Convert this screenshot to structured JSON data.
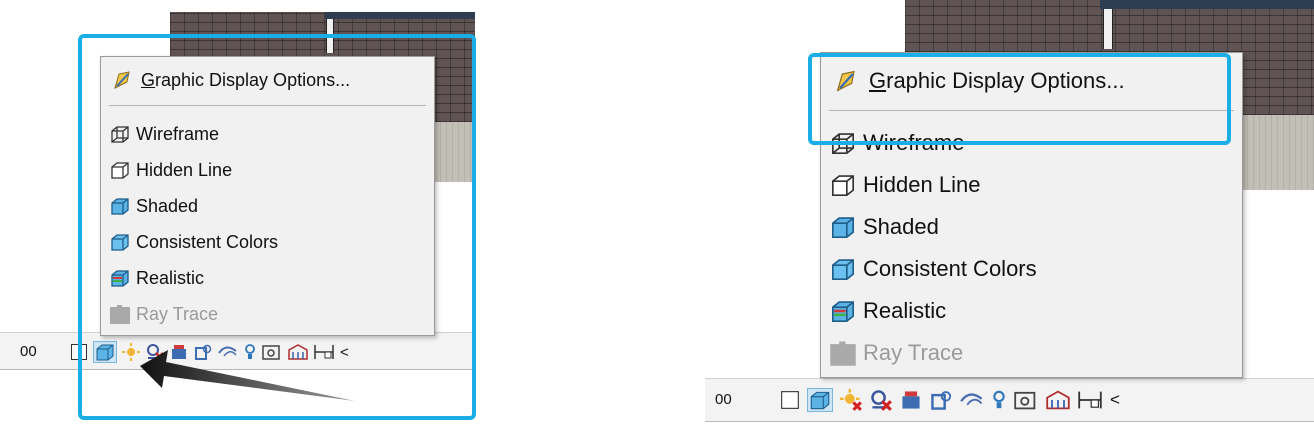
{
  "menu": {
    "graphic_display_options": {
      "prefix": "",
      "mnemonic": "G",
      "rest": "raphic Display Options..."
    },
    "items": [
      {
        "label": "Wireframe",
        "icon": "wireframe-icon"
      },
      {
        "label": "Hidden Line",
        "icon": "hidden-line-icon"
      },
      {
        "label": "Shaded",
        "icon": "shaded-icon"
      },
      {
        "label": "Consistent Colors",
        "icon": "consistent-colors-icon"
      },
      {
        "label": "Realistic",
        "icon": "realistic-icon"
      },
      {
        "label": "Ray Trace",
        "icon": "ray-trace-icon",
        "disabled": true
      }
    ]
  },
  "statusbar": {
    "scale_fragment": "00",
    "overflow": "<",
    "icons": [
      "detail-level-icon",
      "visual-style-icon",
      "sun-path-icon",
      "shadows-icon",
      "show-rendering-dialog-icon",
      "crop-view-icon",
      "show-crop-region-icon",
      "unlock-3d-view-icon",
      "temporary-hide-icon",
      "reveal-hidden-icon",
      "analytical-model-icon",
      "highlight-displacement-icon"
    ]
  },
  "colors": {
    "highlight": "#1aaee6",
    "menu_bg": "#f1f1f1",
    "disabled_text": "#9a9a9a",
    "shaded_blue": "#5cb3e6"
  }
}
